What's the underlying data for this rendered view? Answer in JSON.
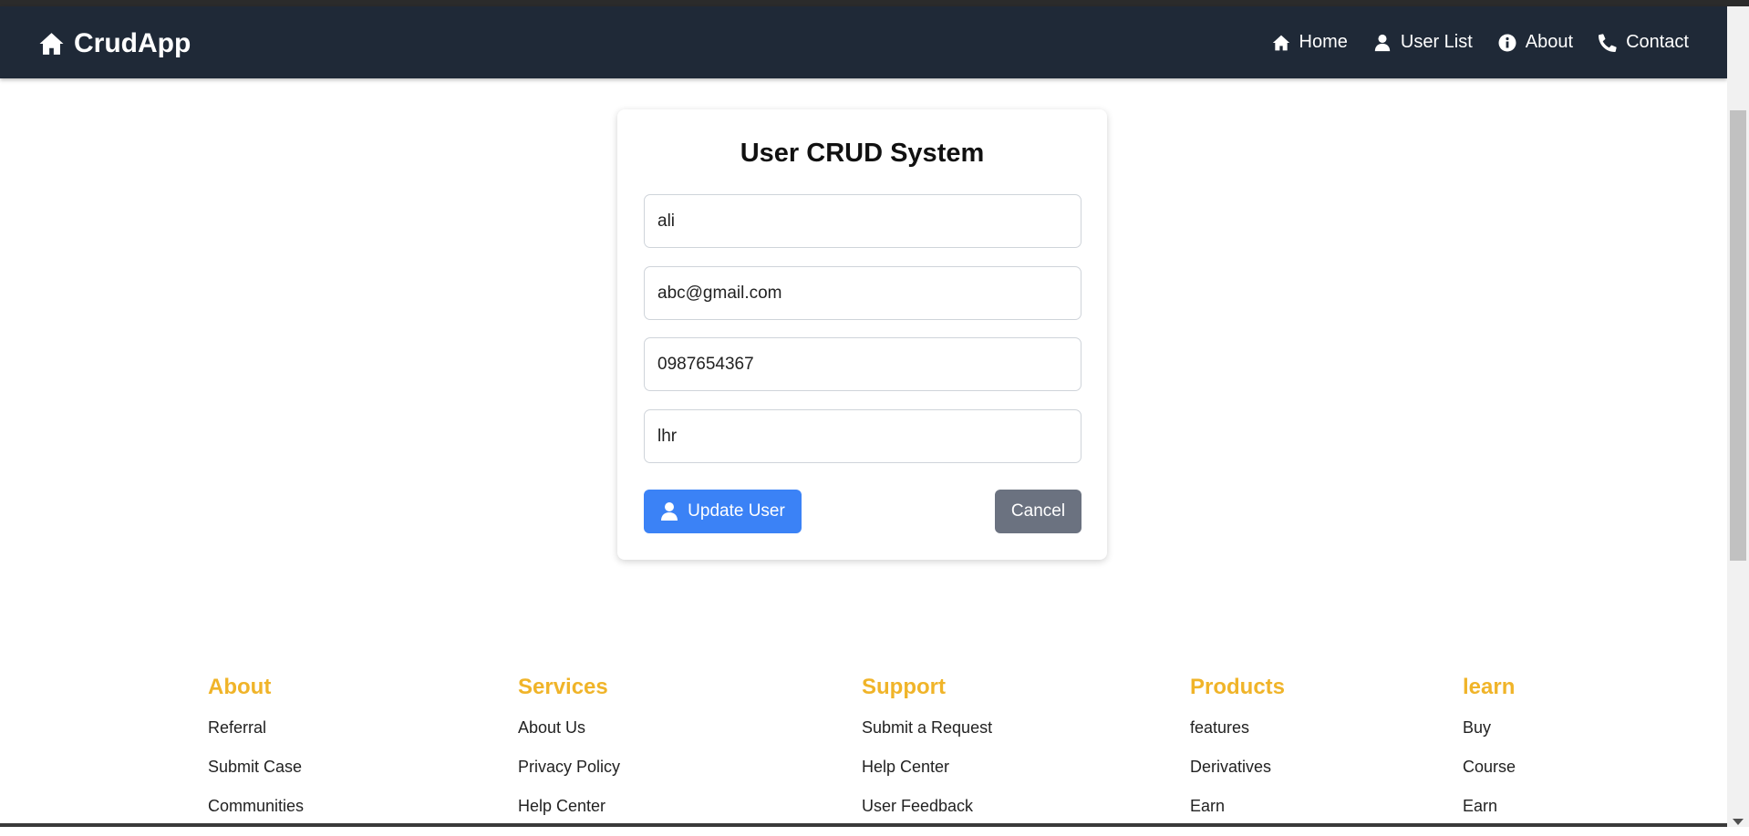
{
  "nav": {
    "brand": "CrudApp",
    "links": [
      {
        "label": "Home",
        "icon": "home-icon"
      },
      {
        "label": "User List",
        "icon": "user-icon"
      },
      {
        "label": "About",
        "icon": "info-icon"
      },
      {
        "label": "Contact",
        "icon": "phone-icon"
      }
    ]
  },
  "form": {
    "title": "User CRUD System",
    "name_value": "ali",
    "email_value": "abc@gmail.com",
    "phone_value": "0987654367",
    "city_value": "lhr",
    "update_label": "Update User",
    "cancel_label": "Cancel"
  },
  "footer": {
    "columns": [
      {
        "heading": "About",
        "links": [
          "Referral",
          "Submit Case",
          "Communities"
        ]
      },
      {
        "heading": "Services",
        "links": [
          "About Us",
          "Privacy Policy",
          "Help Center"
        ]
      },
      {
        "heading": "Support",
        "links": [
          "Submit a Request",
          "Help Center",
          "User Feedback"
        ]
      },
      {
        "heading": "Products",
        "links": [
          "features",
          "Derivatives",
          "Earn"
        ]
      },
      {
        "heading": "learn",
        "links": [
          "Buy",
          "Course",
          "Earn"
        ]
      }
    ]
  },
  "colors": {
    "navbar": "#1f2937",
    "primary_button": "#3b82f6",
    "secondary_button": "#6b7280",
    "footer_heading": "#f0b429"
  }
}
